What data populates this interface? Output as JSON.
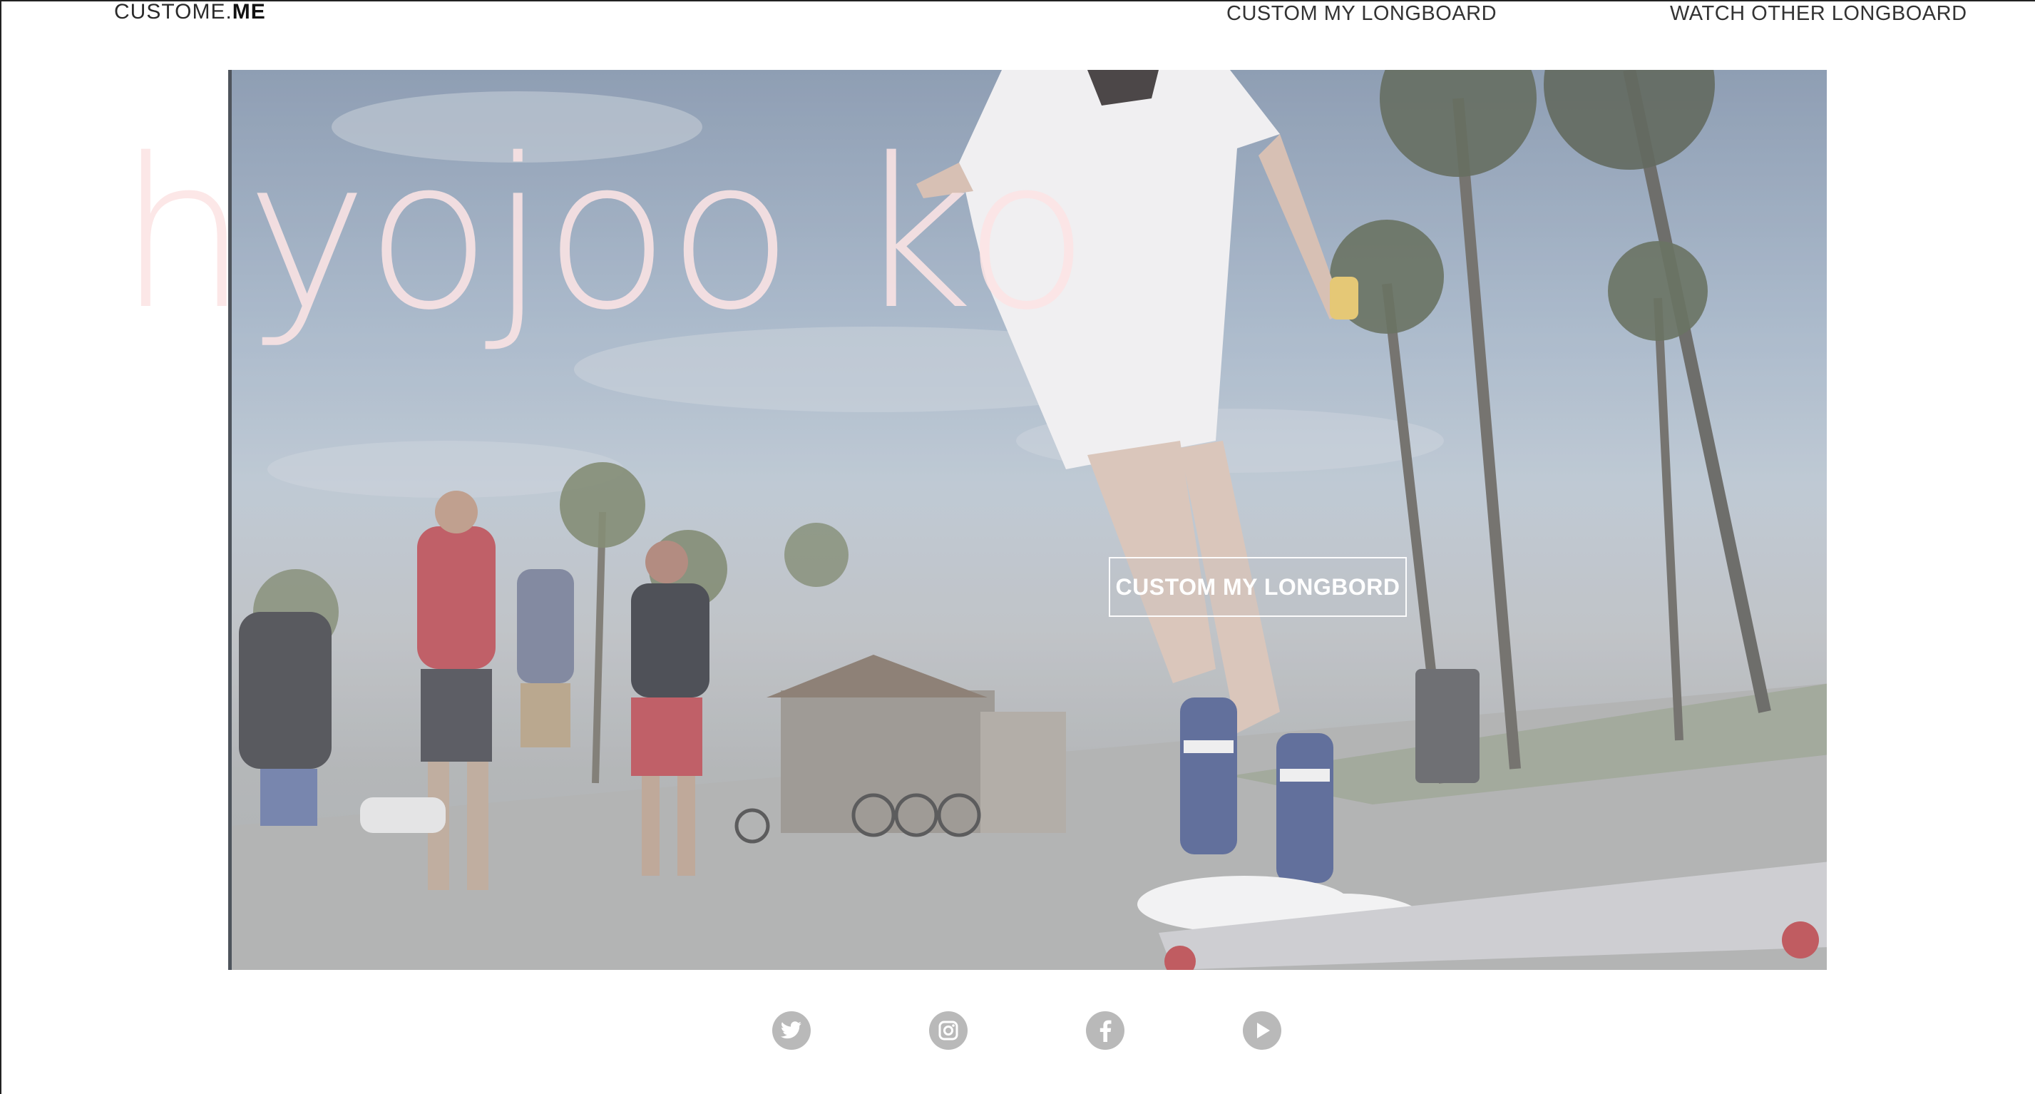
{
  "header": {
    "brand_light": "CUSTOME.",
    "brand_bold": "ME",
    "nav": [
      {
        "label": "CUSTOM MY LONGBOARD"
      },
      {
        "label": "WATCH OTHER LONGBOARD"
      }
    ]
  },
  "hero": {
    "title": "hyojoo ko",
    "cta_label": "CUSTOM MY LONGBORD"
  },
  "social": [
    {
      "icon": "twitter-icon"
    },
    {
      "icon": "instagram-icon"
    },
    {
      "icon": "facebook-icon"
    },
    {
      "icon": "youtube-icon"
    }
  ],
  "colors": {
    "title_color": "#fce4e4",
    "nav_text": "#333333",
    "social_icon_bg": "#b9b9b9"
  }
}
